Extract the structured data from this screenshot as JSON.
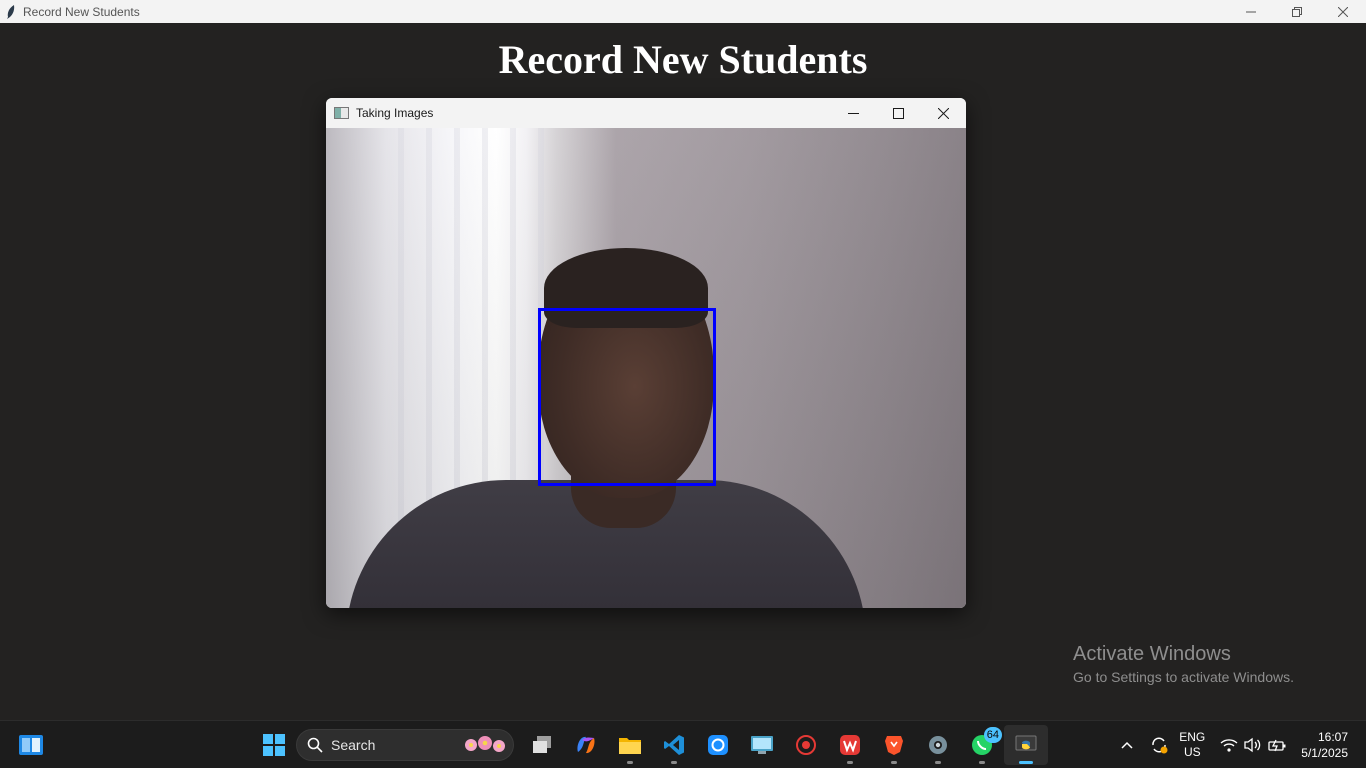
{
  "app": {
    "title": "Record New Students",
    "heading": "Record New Students"
  },
  "camera_window": {
    "title": "Taking Images"
  },
  "watermark": {
    "line1": "Activate Windows",
    "line2": "Go to Settings to activate Windows."
  },
  "taskbar": {
    "search_label": "Search",
    "whatsapp_badge": "64",
    "language": {
      "line1": "ENG",
      "line2": "US"
    },
    "clock": {
      "time": "16:07",
      "date": "5/1/2025"
    }
  },
  "colors": {
    "face_box": "#0000ff",
    "background": "#232221",
    "taskbar": "#1c1c1c",
    "accent": "#4cc2ff"
  }
}
